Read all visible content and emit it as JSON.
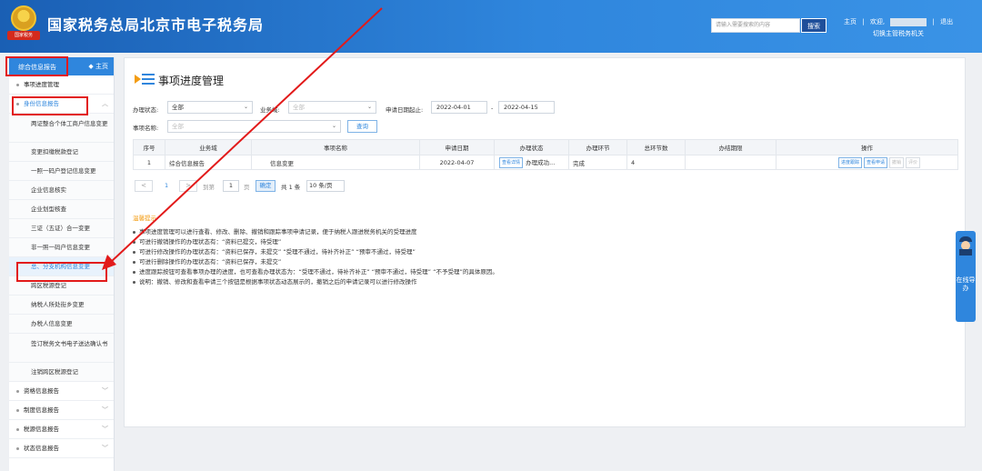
{
  "header": {
    "emblem_text": "国家税务",
    "title": "国家税务总局北京市电子税务局",
    "search_placeholder": "请输入需要搜索的内容",
    "search_button": "搜索",
    "home_link": "主页",
    "welcome": "欢迎,",
    "logout": "退出",
    "switch_org": "切换主管税务机关"
  },
  "sidebar": {
    "head_title": "综合信息报告",
    "head_home": "◆ 主页",
    "top_items": [
      "事项进度管理",
      "身份信息报告"
    ],
    "sub_items": [
      "两证整合个体工商户信息变更",
      "变更扣缴税款登记",
      "一照一码户登记信息变更",
      "企业信息核实",
      "企业划型核查",
      "三证（五证）合一变更",
      "非一照一码户信息变更",
      "总、分支机构信息变更",
      "跨区税源登记",
      "纳税人所处街乡变更",
      "办税人信息变更",
      "签订税务文书电子送达确认书",
      "注销跨区税源登记"
    ],
    "bottom_items": [
      "资格信息报告",
      "制度信息报告",
      "税源信息报告",
      "状态信息报告"
    ]
  },
  "main": {
    "title": "事项进度管理",
    "filters": {
      "status_label": "办理状态:",
      "status_value": "全部",
      "business_label": "业务域:",
      "business_placeholder": "全部",
      "date_label": "申请日期起止:",
      "date_from": "2022-04-01",
      "date_sep": "-",
      "date_to": "2022-04-15",
      "item_label": "事项名称:",
      "item_placeholder": "全部",
      "query_button": "查询"
    },
    "table": {
      "headers": [
        "序号",
        "业务域",
        "事项名称",
        "申请日期",
        "办理状态",
        "办理环节",
        "总环节数",
        "办结期限",
        "操作"
      ],
      "row": {
        "index": "1",
        "domain": "综合信息报告",
        "item": "信息变更",
        "date": "2022-04-07",
        "status_btn": "查看详情",
        "status": "办理成功...",
        "stage": "完成",
        "total": "4",
        "deadline": "",
        "actions": [
          "进度跟踪",
          "查看申请",
          "撤销",
          "评价"
        ]
      }
    },
    "pagination": {
      "prev": "<",
      "page": "1",
      "next": ">",
      "goto_label": "到第",
      "goto_value": "1",
      "page_unit": "页",
      "confirm": "确定",
      "total": "共 1 条",
      "page_size": "10 条/页"
    },
    "tips": {
      "title": "温馨提示",
      "lines": [
        "事项进度管理可以进行查看、修改、删除、撤销和跟踪事项申请记录，便于纳税人跟进税务机关的受理进度",
        "可进行撤销操作的办理状态有：“资料已提交，待受理”",
        "可进行修改操作的办理状态有：“资料已保存，未提交” “受理不通过，待补齐补正” “预审不通过，待受理”",
        "可进行删除操作的办理状态有：“资料已保存，未提交”",
        "进度跟踪按钮可查看事项办理的进度，也可查看办理状态为：“受理不通过，待补齐补正” “预审不通过，待受理” “不予受理”的具体原因。",
        "说明：撤销、修改和查看申请三个按钮是根据事项状态动态展示的，撤销之后的申请记录可以进行修改操作"
      ]
    }
  },
  "float_tab": {
    "text": "在线导办"
  },
  "colors": {
    "header_blue": "#2f86dd",
    "link_blue": "#2f86dd",
    "annotation_red": "#e21a1a",
    "tip_orange": "#f39c12"
  }
}
